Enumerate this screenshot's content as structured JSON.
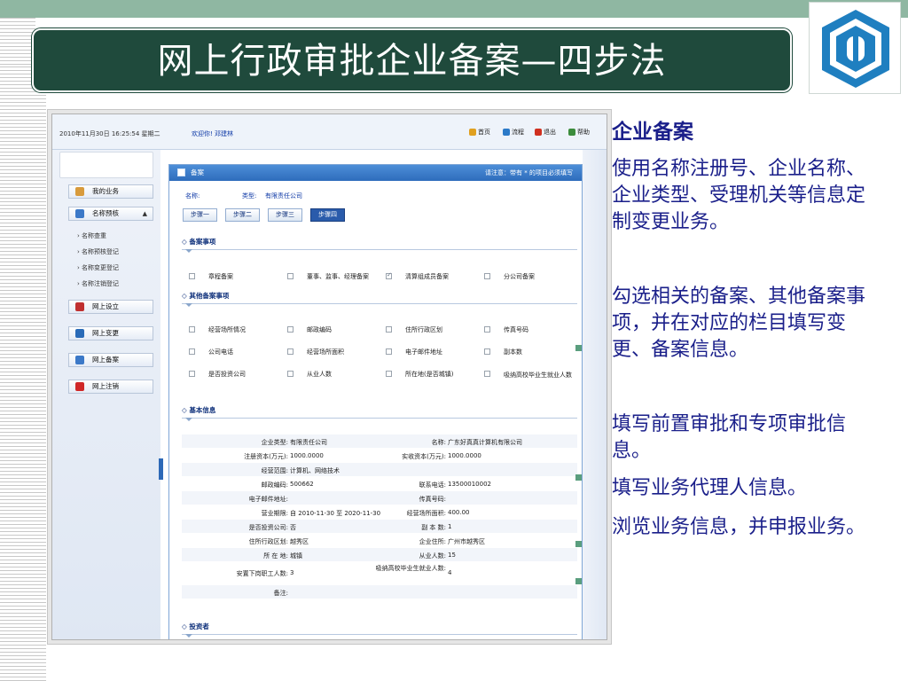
{
  "slide": {
    "title": "网上行政审批企业备案—四步法"
  },
  "app": {
    "datetime": "2010年11月30日 16:25:54 星期二",
    "welcome": "欢迎你! 邓建林",
    "nav": [
      {
        "label": "首页",
        "icon": "home-icon",
        "color": "#e0a020"
      },
      {
        "label": "流程",
        "icon": "flow-icon",
        "color": "#2c7ac8"
      },
      {
        "label": "退出",
        "icon": "logout-icon",
        "color": "#d03020"
      },
      {
        "label": "帮助",
        "icon": "help-icon",
        "color": "#3c8c3c"
      }
    ],
    "sidebar": {
      "my_business": "我的业务",
      "name_precheck": "名称预核",
      "sub_items": [
        "名称查重",
        "名称预核登记",
        "名称变更登记",
        "名称注销登记"
      ],
      "online_setup": "网上设立",
      "online_change": "网上变更",
      "online_filing": "网上备案",
      "online_cancel": "网上注销"
    },
    "panel": {
      "title": "备案",
      "hint": "请注意：带有 * 的项目必须填写",
      "name_label": "名称:",
      "type_label": "类型:",
      "type_value": "有限责任公司",
      "steps": [
        "步骤一",
        "步骤二",
        "步骤三",
        "步骤四"
      ],
      "section_filing": "备案事项",
      "filing_items": [
        {
          "label": "章程备案",
          "checked": false
        },
        {
          "label": "董事、监事、经理备案",
          "checked": false
        },
        {
          "label": "清算组成员备案",
          "checked": true
        },
        {
          "label": "分公司备案",
          "checked": false
        }
      ],
      "section_other": "其他备案事项",
      "other_items": [
        "经营场所情况",
        "邮政编码",
        "住所行政区划",
        "传真号码",
        "公司电话",
        "经营场所面积",
        "电子邮件地址",
        "副本数",
        "是否投资公司",
        "从业人数",
        "所在地(是否城镇)",
        "吸纳高校毕业生就业人数"
      ],
      "section_basic": "基本信息",
      "basic_rows": [
        {
          "k1": "企业类型:",
          "v1": "有限责任公司",
          "k2": "名称:",
          "v2": "广东好真真计算机有限公司"
        },
        {
          "k1": "注册资本(万元):",
          "v1": "1000.0000",
          "k2": "实收资本(万元):",
          "v2": "1000.0000"
        },
        {
          "k1": "经营范围:",
          "v1": "计算机、网络技术",
          "k2": "",
          "v2": ""
        },
        {
          "k1": "邮政编码:",
          "v1": "500662",
          "k2": "联系电话:",
          "v2": "13500010002"
        },
        {
          "k1": "电子邮件地址:",
          "v1": "",
          "k2": "传真号码:",
          "v2": ""
        },
        {
          "k1": "营业期限:",
          "v1": "自 2010-11-30 至 2020-11-30",
          "k2": "经营场所面积:",
          "v2": "400.00"
        },
        {
          "k1": "是否投资公司:",
          "v1": "否",
          "k2": "副 本 数:",
          "v2": "1"
        },
        {
          "k1": "住所行政区划:",
          "v1": "越秀区",
          "k2": "企业住所:",
          "v2": "广州市越秀区"
        },
        {
          "k1": "所 在 地:",
          "v1": "城镇",
          "k2": "从业人数:",
          "v2": "15"
        },
        {
          "k1": "安置下岗职工人数:",
          "v1": "3",
          "k2": "吸纳高校毕业生就业人数:",
          "v2": "4"
        },
        {
          "k1": "备注:",
          "v1": "",
          "k2": "",
          "v2": ""
        }
      ],
      "section_investor": "投资者"
    }
  },
  "right_text": {
    "heading": "企业备案",
    "p1": "使用名称注册号、企业名称、企业类型、受理机关等信息定制变更业务。",
    "p2": "勾选相关的备案、其他备案事项，并在对应的栏目填写变更、备案信息。",
    "p3": "填写前置审批和专项审批信息。",
    "p4": "填写业务代理人信息。",
    "p5": "浏览业务信息，并申报业务。"
  },
  "colors": {
    "title_bg": "#1f4a3c",
    "top_band": "#8fb7a2",
    "text_blue": "#1a1f8a",
    "panel_header": "#2e6cbc"
  }
}
